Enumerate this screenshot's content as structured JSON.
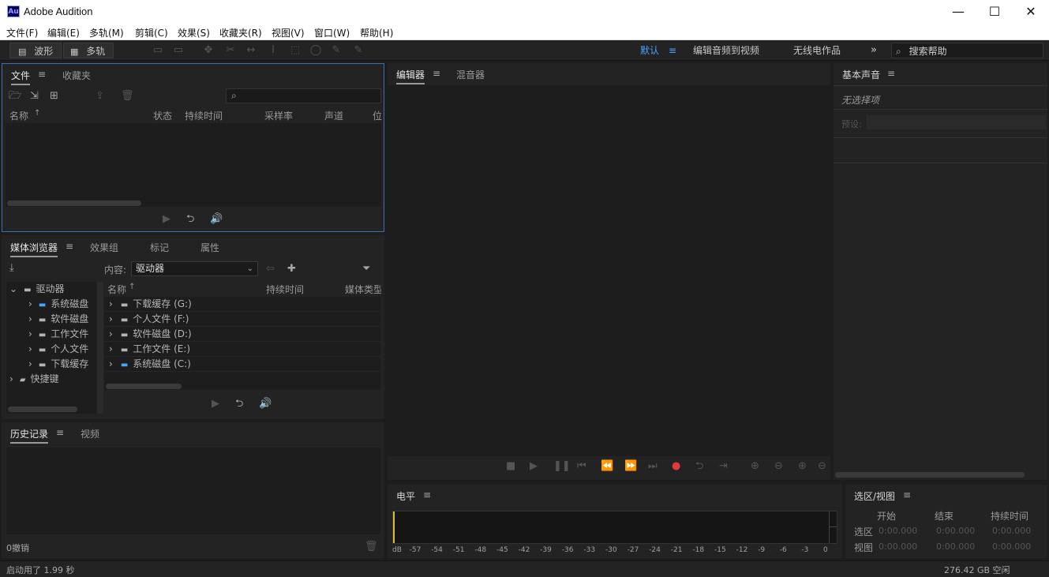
{
  "app": {
    "logo": "Au",
    "title": "Adobe Audition"
  },
  "window_controls": {
    "minimize": "—",
    "maximize": "☐",
    "close": "✕"
  },
  "menu": [
    "文件(F)",
    "编辑(E)",
    "多轨(M)",
    "剪辑(C)",
    "效果(S)",
    "收藏夹(R)",
    "视图(V)",
    "窗口(W)",
    "帮助(H)"
  ],
  "toolbar": {
    "waveform_label": "波形",
    "multitrack_label": "多轨",
    "workspaces": [
      "默认",
      "编辑音频到视频",
      "无线电作品"
    ],
    "active_workspace": "默认",
    "search_placeholder": "搜索帮助"
  },
  "files_panel": {
    "tabs": [
      "文件",
      "收藏夹"
    ],
    "columns": [
      "名称",
      "状态",
      "持续时间",
      "采样率",
      "声道",
      "位"
    ]
  },
  "media_browser": {
    "tabs": [
      "媒体浏览器",
      "效果组",
      "标记",
      "属性"
    ],
    "content_label": "内容:",
    "content_value": "驱动器",
    "tree": [
      {
        "label": "驱动器",
        "level": 0
      },
      {
        "label": "系统磁盘",
        "level": 1
      },
      {
        "label": "软件磁盘",
        "level": 1
      },
      {
        "label": "工作文件",
        "level": 1
      },
      {
        "label": "个人文件",
        "level": 1
      },
      {
        "label": "下载缓存",
        "level": 1
      },
      {
        "label": "快捷键",
        "level": 0
      }
    ],
    "columns": [
      "名称",
      "持续时间",
      "媒体类型"
    ],
    "rows": [
      "下载缓存 (G:)",
      "个人文件 (F:)",
      "软件磁盘 (D:)",
      "工作文件 (E:)",
      "系统磁盘 (C:)"
    ]
  },
  "history_panel": {
    "tabs": [
      "历史记录",
      "视频"
    ],
    "undo_count": "0撤销"
  },
  "editor_panel": {
    "tabs": [
      "编辑器",
      "混音器"
    ]
  },
  "essential_sound": {
    "title": "基本声音",
    "no_selection": "无选择项",
    "preset_label": "预设:"
  },
  "level_meter": {
    "title": "电平",
    "ticks": [
      "dB",
      "-57",
      "-54",
      "-51",
      "-48",
      "-45",
      "-42",
      "-39",
      "-36",
      "-33",
      "-30",
      "-27",
      "-24",
      "-21",
      "-18",
      "-15",
      "-12",
      "-9",
      "-6",
      "-3",
      "0"
    ]
  },
  "selection_view": {
    "title": "选区/视图",
    "columns": [
      "开始",
      "结束",
      "持续时间"
    ],
    "rows": [
      {
        "label": "选区",
        "start": "0:00.000",
        "end": "0:00.000",
        "duration": "0:00.000"
      },
      {
        "label": "视图",
        "start": "0:00.000",
        "end": "0:00.000",
        "duration": "0:00.000"
      }
    ]
  },
  "status": {
    "left": "启动用了 1.99 秒",
    "disk": "276.42 GB 空闲"
  },
  "colors": {
    "accent": "#4aa3ff",
    "record": "#e23a3a",
    "panel": "#232323",
    "body": "#1d1d1d"
  }
}
